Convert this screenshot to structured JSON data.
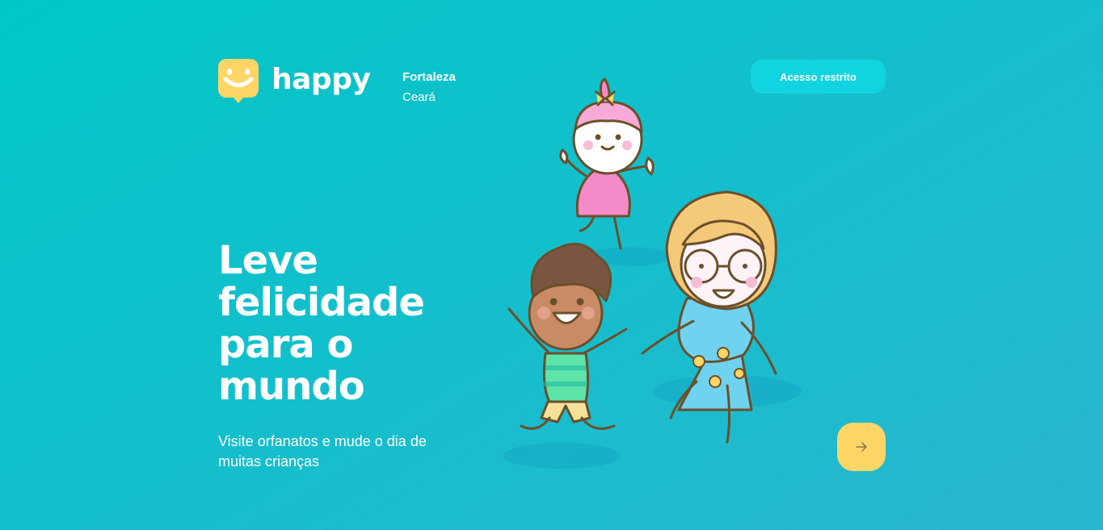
{
  "brand": {
    "name": "happy",
    "accent": "#FFD666"
  },
  "header": {
    "city": "Fortaleza",
    "state": "Ceará",
    "restricted_label": "Acesso restrito"
  },
  "hero": {
    "headline": "Leve felicidade para o mundo",
    "subtitle": "Visite orfanatos e mude o dia de muitas crianças"
  },
  "icons": {
    "enter": "arrow-right-icon",
    "logo": "smile-chat-icon"
  },
  "colors": {
    "bg_start": "#00C7C7",
    "bg_end": "#29B6D1",
    "button": "#12D4E0",
    "enter_button": "#FFD666"
  }
}
